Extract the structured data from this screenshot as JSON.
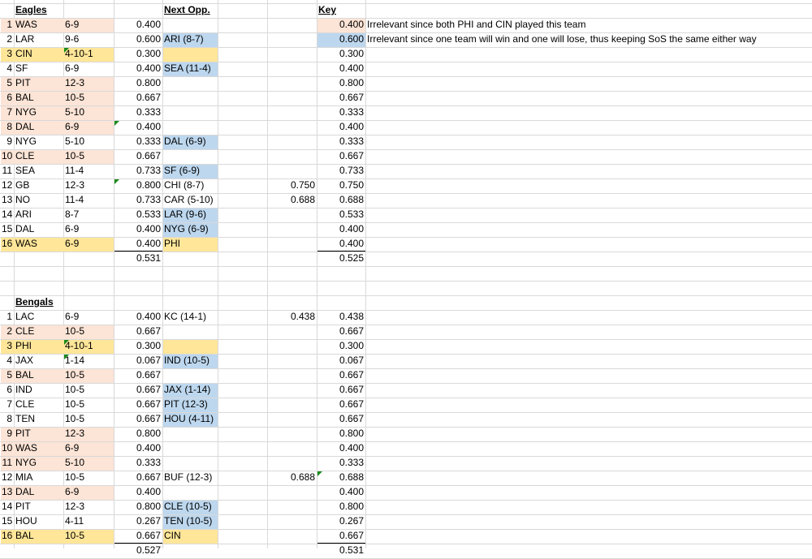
{
  "eagles": {
    "header": "Eagles",
    "rows": [
      {
        "num": "1",
        "team": "WAS",
        "rec": "6-9",
        "pct": "0.400",
        "opp": "",
        "extra": "",
        "final": "0.400",
        "hl": "pink"
      },
      {
        "num": "2",
        "team": "LAR",
        "rec": "9-6",
        "pct": "0.600",
        "opp": "ARI (8-7)",
        "extra": "",
        "final": "0.600",
        "hl": "blue"
      },
      {
        "num": "3",
        "team": "CIN",
        "rec": "4-10-1",
        "pct": "0.300",
        "opp": "",
        "extra": "",
        "final": "0.300",
        "hl": "yellow"
      },
      {
        "num": "4",
        "team": "SF",
        "rec": "6-9",
        "pct": "0.400",
        "opp": "SEA (11-4)",
        "extra": "",
        "final": "0.400",
        "hl": "blue"
      },
      {
        "num": "5",
        "team": "PIT",
        "rec": "12-3",
        "pct": "0.800",
        "opp": "",
        "extra": "",
        "final": "0.800",
        "hl": "pink"
      },
      {
        "num": "6",
        "team": "BAL",
        "rec": "10-5",
        "pct": "0.667",
        "opp": "",
        "extra": "",
        "final": "0.667",
        "hl": "pink"
      },
      {
        "num": "7",
        "team": "NYG",
        "rec": "5-10",
        "pct": "0.333",
        "opp": "",
        "extra": "",
        "final": "0.333",
        "hl": "pink"
      },
      {
        "num": "8",
        "team": "DAL",
        "rec": "6-9",
        "pct": "0.400",
        "opp": "",
        "extra": "",
        "final": "0.400",
        "hl": "pink"
      },
      {
        "num": "9",
        "team": "NYG",
        "rec": "5-10",
        "pct": "0.333",
        "opp": "DAL (6-9)",
        "extra": "",
        "final": "0.333",
        "hl": "blue"
      },
      {
        "num": "10",
        "team": "CLE",
        "rec": "10-5",
        "pct": "0.667",
        "opp": "",
        "extra": "",
        "final": "0.667",
        "hl": "pink"
      },
      {
        "num": "11",
        "team": "SEA",
        "rec": "11-4",
        "pct": "0.733",
        "opp": "SF (6-9)",
        "extra": "",
        "final": "0.733",
        "hl": "blue"
      },
      {
        "num": "12",
        "team": "GB",
        "rec": "12-3",
        "pct": "0.800",
        "opp": "CHI (8-7)",
        "extra": "0.750",
        "final": "0.750",
        "hl": ""
      },
      {
        "num": "13",
        "team": "NO",
        "rec": "11-4",
        "pct": "0.733",
        "opp": "CAR (5-10)",
        "extra": "0.688",
        "final": "0.688",
        "hl": ""
      },
      {
        "num": "14",
        "team": "ARI",
        "rec": "8-7",
        "pct": "0.533",
        "opp": "LAR (9-6)",
        "extra": "",
        "final": "0.533",
        "hl": "blue"
      },
      {
        "num": "15",
        "team": "DAL",
        "rec": "6-9",
        "pct": "0.400",
        "opp": "NYG (6-9)",
        "extra": "",
        "final": "0.400",
        "hl": "blue"
      },
      {
        "num": "16",
        "team": "WAS",
        "rec": "6-9",
        "pct": "0.400",
        "opp": "PHI",
        "extra": "",
        "final": "0.400",
        "hl": "yellow"
      }
    ],
    "total_pct": "0.531",
    "total_final": "0.525"
  },
  "next_opp_header": "Next Opp.",
  "key": {
    "header": "Key",
    "items": [
      {
        "color": "pink",
        "text": "Irrelevant since both PHI and CIN played this team"
      },
      {
        "color": "blue",
        "text": "Irrelevant since one team will win and one will lose, thus keeping SoS the same either way"
      }
    ]
  },
  "bengals": {
    "header": "Bengals",
    "rows": [
      {
        "num": "1",
        "team": "LAC",
        "rec": "6-9",
        "pct": "0.400",
        "opp": "KC (14-1)",
        "extra": "0.438",
        "final": "0.438",
        "hl": ""
      },
      {
        "num": "2",
        "team": "CLE",
        "rec": "10-5",
        "pct": "0.667",
        "opp": "",
        "extra": "",
        "final": "0.667",
        "hl": "pink"
      },
      {
        "num": "3",
        "team": "PHI",
        "rec": "4-10-1",
        "pct": "0.300",
        "opp": "",
        "extra": "",
        "final": "0.300",
        "hl": "yellow"
      },
      {
        "num": "4",
        "team": "JAX",
        "rec": "1-14",
        "pct": "0.067",
        "opp": "IND (10-5)",
        "extra": "",
        "final": "0.067",
        "hl": "blue"
      },
      {
        "num": "5",
        "team": "BAL",
        "rec": "10-5",
        "pct": "0.667",
        "opp": "",
        "extra": "",
        "final": "0.667",
        "hl": "pink"
      },
      {
        "num": "6",
        "team": "IND",
        "rec": "10-5",
        "pct": "0.667",
        "opp": "JAX (1-14)",
        "extra": "",
        "final": "0.667",
        "hl": "blue"
      },
      {
        "num": "7",
        "team": "CLE",
        "rec": "10-5",
        "pct": "0.667",
        "opp": "PIT (12-3)",
        "extra": "",
        "final": "0.667",
        "hl": "blue"
      },
      {
        "num": "8",
        "team": "TEN",
        "rec": "10-5",
        "pct": "0.667",
        "opp": "HOU (4-11)",
        "extra": "",
        "final": "0.667",
        "hl": "blue"
      },
      {
        "num": "9",
        "team": "PIT",
        "rec": "12-3",
        "pct": "0.800",
        "opp": "",
        "extra": "",
        "final": "0.800",
        "hl": "pink"
      },
      {
        "num": "10",
        "team": "WAS",
        "rec": "6-9",
        "pct": "0.400",
        "opp": "",
        "extra": "",
        "final": "0.400",
        "hl": "pink"
      },
      {
        "num": "11",
        "team": "NYG",
        "rec": "5-10",
        "pct": "0.333",
        "opp": "",
        "extra": "",
        "final": "0.333",
        "hl": "pink"
      },
      {
        "num": "12",
        "team": "MIA",
        "rec": "10-5",
        "pct": "0.667",
        "opp": "BUF (12-3)",
        "extra": "0.688",
        "final": "0.688",
        "hl": ""
      },
      {
        "num": "13",
        "team": "DAL",
        "rec": "6-9",
        "pct": "0.400",
        "opp": "",
        "extra": "",
        "final": "0.400",
        "hl": "pink"
      },
      {
        "num": "14",
        "team": "PIT",
        "rec": "12-3",
        "pct": "0.800",
        "opp": "CLE (10-5)",
        "extra": "",
        "final": "0.800",
        "hl": "blue"
      },
      {
        "num": "15",
        "team": "HOU",
        "rec": "4-11",
        "pct": "0.267",
        "opp": "TEN (10-5)",
        "extra": "",
        "final": "0.267",
        "hl": "blue"
      },
      {
        "num": "16",
        "team": "BAL",
        "rec": "10-5",
        "pct": "0.667",
        "opp": "CIN",
        "extra": "",
        "final": "0.667",
        "hl": "yellow"
      }
    ],
    "total_pct": "0.527",
    "total_final": "0.531"
  },
  "colors": {
    "pink": "#fce4d6",
    "blue": "#bdd7ee",
    "yellow": "#ffe699",
    "grid": "#d9d9d9"
  }
}
